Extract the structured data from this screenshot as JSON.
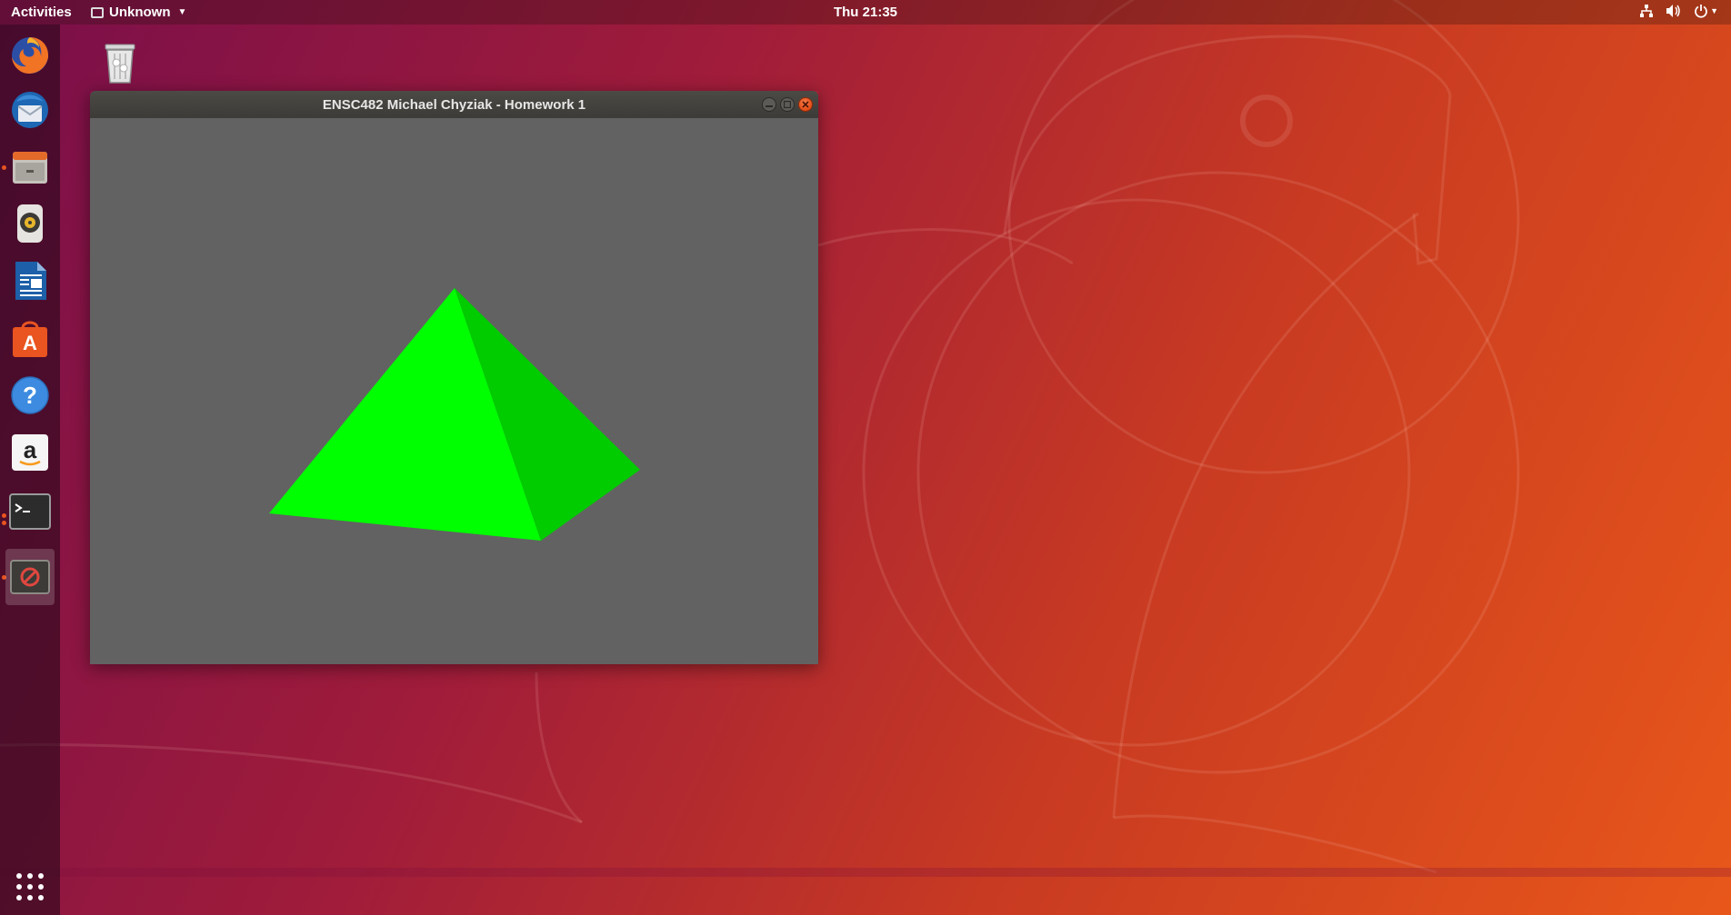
{
  "topbar": {
    "activities_label": "Activities",
    "app_menu_label": "Unknown",
    "clock": "Thu 21:35",
    "tray_icons": [
      "network-icon",
      "volume-icon",
      "power-icon"
    ]
  },
  "dock": {
    "items": [
      {
        "name": "Firefox",
        "icon": "firefox-icon",
        "running": false
      },
      {
        "name": "Thunderbird",
        "icon": "thunderbird-icon",
        "running": false
      },
      {
        "name": "Files",
        "icon": "files-icon",
        "running": true
      },
      {
        "name": "Rhythmbox",
        "icon": "rhythmbox-icon",
        "running": false
      },
      {
        "name": "LibreOffice Writer",
        "icon": "writer-icon",
        "running": false
      },
      {
        "name": "Ubuntu Software",
        "icon": "software-icon",
        "running": false
      },
      {
        "name": "Help",
        "icon": "help-icon",
        "running": false
      },
      {
        "name": "Amazon",
        "icon": "amazon-icon",
        "running": false
      },
      {
        "name": "Terminal",
        "icon": "terminal-icon",
        "running": true
      },
      {
        "name": "Homework 1",
        "icon": "app-window-icon",
        "running": true,
        "active": true
      }
    ],
    "show_apps_icon": "grid-icon"
  },
  "desktop": {
    "trash_icon": "trash-icon"
  },
  "window": {
    "title": "ENSC482 Michael Chyziak - Homework 1",
    "canvas_color": "#626262",
    "pyramid_front_color": "#00ff00",
    "pyramid_side_color": "#00cc00"
  },
  "colors": {
    "accent": "#e95420",
    "wallpaper_left": "#7a0f4a",
    "wallpaper_right": "#e8571a"
  }
}
